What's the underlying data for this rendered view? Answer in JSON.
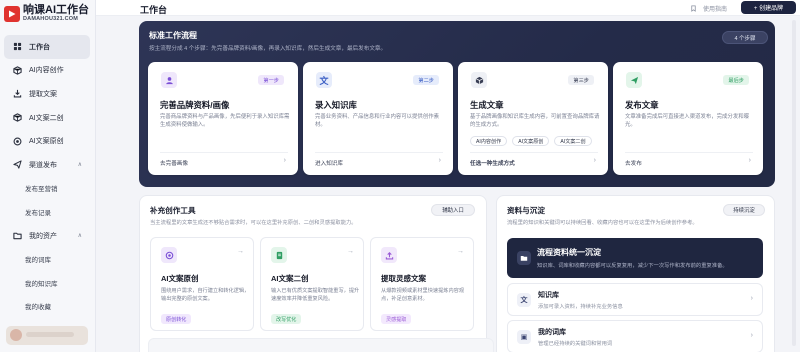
{
  "brand": {
    "name": "响课AI工作台",
    "domain": "DAMAHOU321.COM"
  },
  "sidebar": {
    "items": [
      {
        "label": "工作台",
        "icon": "grid-icon",
        "active": true
      },
      {
        "label": "AI内容创作",
        "icon": "cube-icon"
      },
      {
        "label": "提取文案",
        "icon": "download-icon"
      },
      {
        "label": "AI文案二创",
        "icon": "cube-icon"
      },
      {
        "label": "AI文案原创",
        "icon": "circle-icon"
      },
      {
        "label": "渠道发布",
        "icon": "send-icon",
        "caret": "∧"
      },
      {
        "label": "发布至营销",
        "sub": true
      },
      {
        "label": "发布记录",
        "sub": true
      },
      {
        "label": "我的资产",
        "icon": "folder-icon",
        "caret": "∧"
      },
      {
        "label": "我的词库",
        "sub": true
      },
      {
        "label": "我的知识库",
        "sub": true
      },
      {
        "label": "我的收藏",
        "sub": true
      }
    ]
  },
  "header": {
    "title": "工作台",
    "feedback_link": "使用指南",
    "create_button": "+ 创建品牌"
  },
  "hero": {
    "title": "标准工作流程",
    "subtitle": "按主流程分成 4 个步骤：先完善品牌资料/画像，再录入知识库，然后生成文章，最后发布文章。",
    "pill": "4 个步骤",
    "steps": [
      {
        "badge": "第一步",
        "title": "完善品牌资料/画像",
        "desc": "完善商品牌资料与产品画像，先后便利于录入知识库需生成资料使做输入。",
        "link": "去完善画像",
        "arrow": "›",
        "icon": "user-icon",
        "color": "#7b4fd6",
        "bg": "#efe7fb"
      },
      {
        "badge": "第二步",
        "title": "录入知识库",
        "desc": "完善业务资料、产品信息和行业内容可以提供创作素材。",
        "link": "进入知识库",
        "arrow": "›",
        "icon": "wen-icon",
        "color": "#3c5fc4",
        "bg": "#e6ecfb"
      },
      {
        "badge": "第三步",
        "title": "生成文章",
        "desc": "基于品牌画像和知识库生成内容，可前置查询品牌库请的生成方式。",
        "link": "任选一种生成方式",
        "arrow": "›",
        "icon": "cube-icon",
        "color": "#3a3f55",
        "bg": "#eef0f5",
        "tags": [
          "AI内容创作",
          "AI文案原创",
          "AI文案二创"
        ]
      },
      {
        "badge": "最后步",
        "title": "发布文章",
        "desc": "文章准备完成后可直接进入渠道发布，完成分发和曝光。",
        "link": "去发布",
        "arrow": "›",
        "icon": "send-icon",
        "color": "#2f9e63",
        "bg": "#e3f5ea"
      }
    ]
  },
  "tools": {
    "title": "补充创作工具",
    "subtitle": "当主流程里的文章生成还不够贴合需求时，可以在这里补充原创、二创和灵感提取能力。",
    "button": "辅助入口",
    "cards": [
      {
        "title": "AI文案原创",
        "desc": "围绕用户需求，自行建立和转化逻辑，输出完整的原创文案。",
        "badge": "原创转化",
        "icon": "spark-icon",
        "color": "#7b4fd6",
        "bg": "#efe7fb",
        "badge_bg": "#f1e8fd",
        "badge_color": "#7b4fd6",
        "arrow": "→"
      },
      {
        "title": "AI文案二创",
        "desc": "输入已有优质文案提取智能重写，提升速度效率并降低重复风险。",
        "badge": "改写优化",
        "icon": "doc-icon",
        "color": "#2f9e63",
        "bg": "#e3f5ea",
        "badge_bg": "#e3f5ea",
        "badge_color": "#2f9e63",
        "arrow": "→"
      },
      {
        "title": "提取灵感文案",
        "desc": "从爆款视频或素材里快速提炼内容观点，补足创意素材。",
        "badge": "灵感提取",
        "icon": "upload-icon",
        "color": "#9a5ad6",
        "bg": "#f1e8fb",
        "badge_bg": "#f3e9fd",
        "badge_color": "#9a5ad6",
        "arrow": "→"
      }
    ]
  },
  "resources": {
    "title": "资料与沉淀",
    "subtitle": "流程里的知识和关键词可以持续回看、收藏内容也可以在这里作为后续创作参考。",
    "button": "持续沉淀",
    "featured": {
      "title": "流程资料统一沉淀",
      "desc": "知识库、词库和收藏内容都可以反复复用，减少下一次写作和发布前的重复准备。",
      "icon": "folder-icon"
    },
    "items": [
      {
        "title": "知识库",
        "desc": "添加可录入资料，持续补充业务信息",
        "icon": "文",
        "arrow": "›"
      },
      {
        "title": "我的词库",
        "desc": "管理已经持续的关键词和常用词",
        "icon": "▣",
        "arrow": "›"
      }
    ]
  }
}
